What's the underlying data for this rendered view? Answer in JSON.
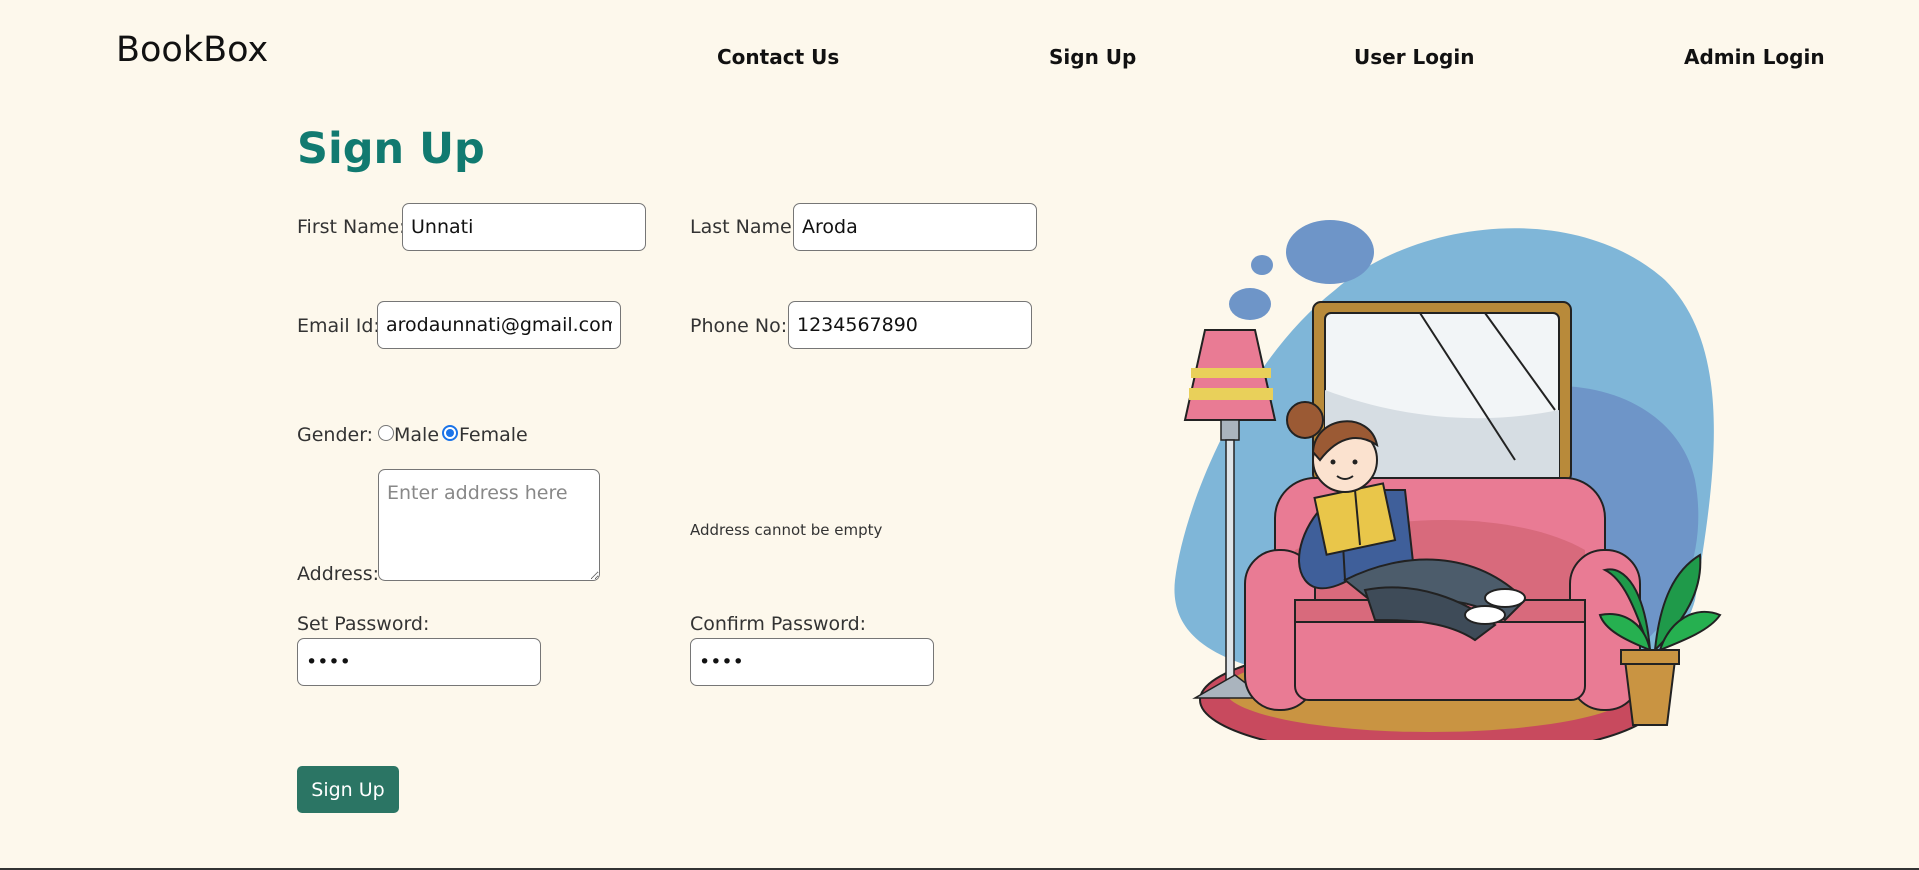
{
  "brand": "BookBox",
  "nav": [
    {
      "label": "Contact Us"
    },
    {
      "label": "Sign Up"
    },
    {
      "label": "User Login"
    },
    {
      "label": "Admin Login"
    }
  ],
  "form": {
    "title": "Sign Up",
    "first_name": {
      "label": "First Name:",
      "value": "Unnati"
    },
    "last_name": {
      "label": "Last Name:",
      "value": "Aroda"
    },
    "email": {
      "label": "Email Id:",
      "value": "arodaunnati@gmail.com"
    },
    "phone": {
      "label": "Phone No:",
      "value": "1234567890"
    },
    "gender": {
      "label": "Gender:",
      "options": [
        "Male",
        "Female"
      ],
      "selected": "Female"
    },
    "address": {
      "label": "Address:",
      "placeholder": "Enter address here",
      "error": "Address cannot be empty"
    },
    "set_password": {
      "label": "Set Password:",
      "value": "1234"
    },
    "confirm_password": {
      "label": "Confirm Password:",
      "value": "1234"
    },
    "submit_label": "Sign Up"
  },
  "colors": {
    "background": "#fdf8ec",
    "title": "#117a70",
    "button": "#2b7564",
    "radio_checked": "#1a73e8"
  },
  "icons": [
    "reading-girl-illustration"
  ]
}
